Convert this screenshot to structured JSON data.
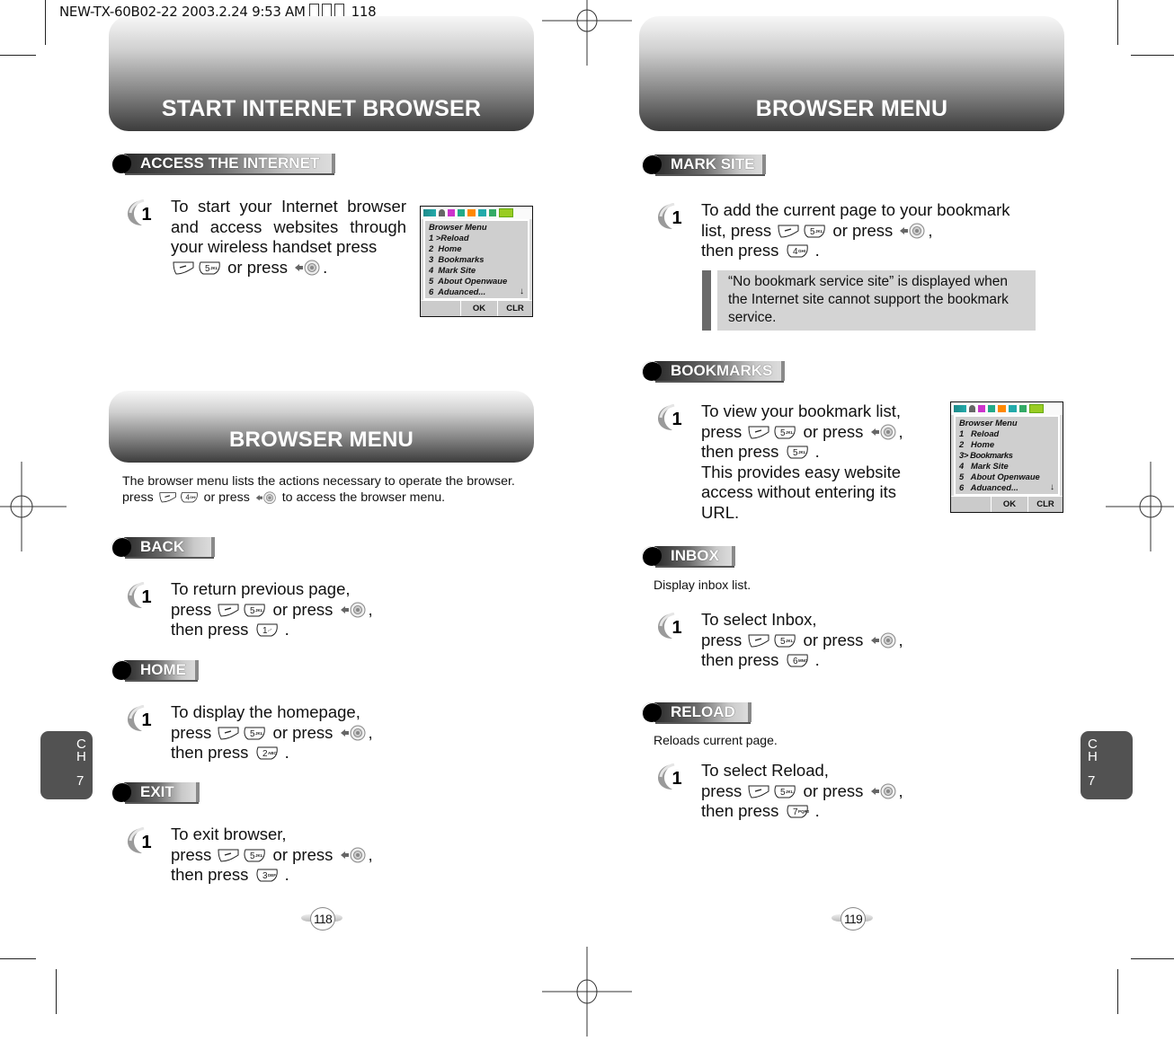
{
  "slug": {
    "text_before": "NEW-TX-60B02-22  2003.2.24 9:53 AM ",
    "text_after": " 118"
  },
  "left_page": {
    "banner_top": "START INTERNET BROWSER",
    "access": {
      "section_title": "ACCESS THE INTERNET",
      "step_number": "1",
      "lines": [
        "To start your Internet browser",
        "and access websites through",
        "your wireless handset press"
      ],
      "line4_mid": " or press ",
      "line4_end": "."
    },
    "phone_screen": {
      "title": "Browser Menu",
      "items": [
        "1 >Reload",
        "2  Home",
        "3  Bookmarks",
        "4  Mark Site",
        "5  About Openwaue",
        "6  Aduanced..."
      ],
      "scroll_arrow": "↓",
      "soft_keys": [
        "",
        "OK",
        "CLR"
      ]
    },
    "banner_mid": "BROWSER MENU",
    "intro": {
      "line1": "The browser menu lists the actions necessary to operate the browser.",
      "line2_start": "press ",
      "line2_mid": " or press ",
      "line2_end": " to access the browser menu."
    },
    "back": {
      "section_title": "BACK",
      "step_number": "1",
      "line1": "To return previous page,",
      "press": "press ",
      "or_press": " or press ",
      "comma": ",",
      "then_press": "then press ",
      "period": " ."
    },
    "home": {
      "section_title": "HOME",
      "step_number": "1",
      "line1": "To display the homepage,",
      "press": "press ",
      "or_press": " or press ",
      "comma": ",",
      "then_press": "then press ",
      "period": " ."
    },
    "exit": {
      "section_title": "EXIT",
      "step_number": "1",
      "line1": "To exit browser,",
      "press": "press ",
      "or_press": " or press ",
      "comma": ",",
      "then_press": "then press ",
      "period": " ."
    },
    "chapter_tab": {
      "c": "C",
      "h": "H",
      "num": "7"
    },
    "page_number": "118"
  },
  "right_page": {
    "banner_top": "BROWSER MENU",
    "mark_site": {
      "section_title": "MARK SITE",
      "step_number": "1",
      "line1": "To add the current page to your bookmark",
      "list_press": "list, press ",
      "or_press": " or press ",
      "comma": ",",
      "then_press": "then press ",
      "period": " .",
      "note": "“No bookmark service site” is displayed when the Internet site cannot support the bookmark service."
    },
    "bookmarks": {
      "section_title": "BOOKMARKS",
      "step_number": "1",
      "line1": "To view your bookmark list,",
      "press": "press ",
      "or_press": " or press ",
      "comma": ",",
      "then_press": "then press ",
      "period": " .",
      "line4": "This provides easy website",
      "line5": "access without entering its",
      "line6": "URL."
    },
    "phone_screen": {
      "title": "Browser Menu",
      "items": [
        "1   Reload",
        "2   Home",
        "3> Bookmarks",
        "4   Mark Site",
        "5   About Openwaue",
        "6   Aduanced..."
      ],
      "scroll_arrow": "↓",
      "soft_keys": [
        "",
        "OK",
        "CLR"
      ]
    },
    "inbox": {
      "section_title": "INBOX",
      "description": "Display inbox list.",
      "step_number": "1",
      "line1": "To select Inbox,",
      "press": "press ",
      "or_press": " or press ",
      "comma": ",",
      "then_press": "then press ",
      "period": " ."
    },
    "reload": {
      "section_title": "RELOAD",
      "description": "Reloads current page.",
      "step_number": "1",
      "line1": "To select Reload,",
      "press": "press ",
      "or_press": " or press ",
      "comma": ",",
      "then_press": "then press ",
      "period": " ."
    },
    "chapter_tab": {
      "c": "C",
      "h": "H",
      "num": "7"
    },
    "page_number": "119"
  },
  "keys": {
    "menu_softkey": "menu-softkey-icon",
    "key_1": {
      "label": "1",
      "sub": ".-'"
    },
    "key_2": {
      "label": "2",
      "sub": "ABC"
    },
    "key_3": {
      "label": "3",
      "sub": "DEF"
    },
    "key_4": {
      "label": "4",
      "sub": "GHI"
    },
    "key_5": {
      "label": "5",
      "sub": "JKL"
    },
    "key_6": {
      "label": "6",
      "sub": "MNO"
    },
    "key_7": {
      "label": "7",
      "sub": "PQRS"
    },
    "nav": "navigation-key-icon"
  }
}
